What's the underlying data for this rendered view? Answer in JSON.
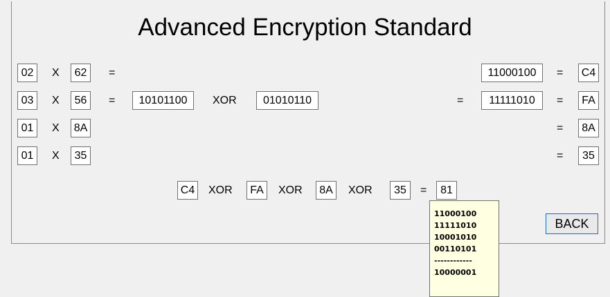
{
  "title": "Advanced Encryption Standard",
  "rows": [
    {
      "coef": "02",
      "op": "X",
      "val": "62",
      "eq": "=",
      "bin_result": "11000100",
      "eq2": "=",
      "hex": "C4"
    },
    {
      "coef": "03",
      "op": "X",
      "val": "56",
      "eq": "=",
      "left_bin": "10101100",
      "xor": "XOR",
      "right_bin": "01010110",
      "eq_mid": "=",
      "bin_result": "11111010",
      "eq2": "=",
      "hex": "FA"
    },
    {
      "coef": "01",
      "op": "X",
      "val": "8A",
      "eq2": "=",
      "hex": "8A"
    },
    {
      "coef": "01",
      "op": "X",
      "val": "35",
      "eq2": "=",
      "hex": "35"
    }
  ],
  "final": {
    "a": "C4",
    "x1": "XOR",
    "b": "FA",
    "x2": "XOR",
    "c": "8A",
    "x3": "XOR",
    "d": "35",
    "eq": "=",
    "result": "81"
  },
  "tooltip": [
    "11000100",
    "11111010",
    "10001010",
    "00110101",
    "------------",
    "10000001"
  ],
  "back_label": "BACK"
}
